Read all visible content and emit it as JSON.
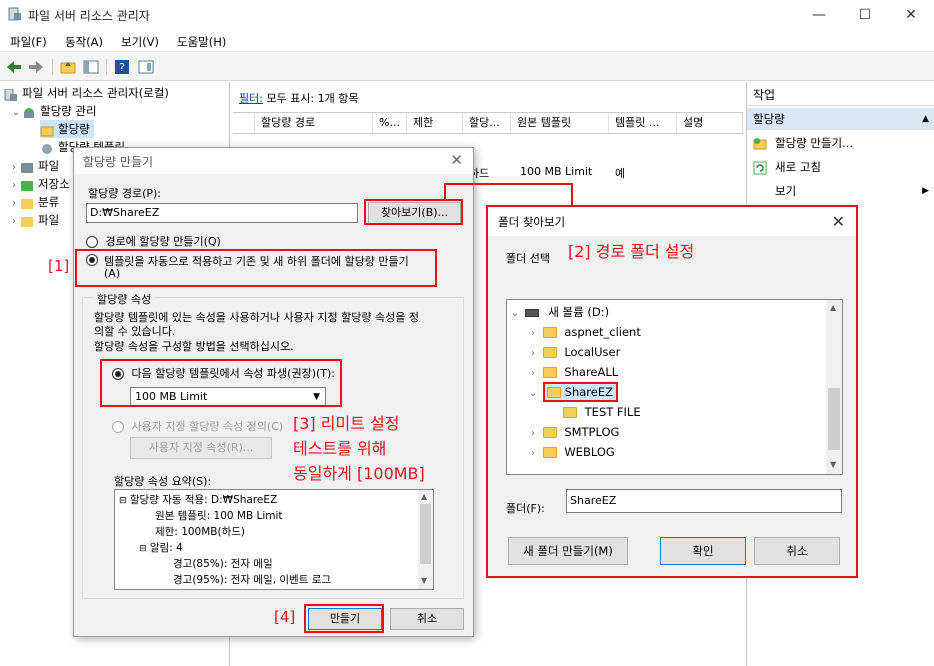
{
  "window": {
    "title": "파일 서버 리소스 관리자",
    "minimize_glyph": "—",
    "maximize_glyph": "☐",
    "close_glyph": "✕"
  },
  "menu": [
    "파일(F)",
    "동작(A)",
    "보기(V)",
    "도움말(H)"
  ],
  "toolbar_icons": [
    "back-arrow-icon",
    "forward-arrow-icon",
    "folder-up-icon",
    "show-hide-tree-icon",
    "help-icon",
    "properties-icon"
  ],
  "tree": {
    "root": "파일 서버 리소스 관리자(로컬)",
    "quota_management": "할당량 관리",
    "quotas": "할당량",
    "quota_templates": "할당량 템플릿",
    "file_screen": "파일",
    "storage_reports": "저장소",
    "classification": "분류",
    "file_management": "파일"
  },
  "center": {
    "filter_link": "필터:",
    "filter_text": "모두 표시: 1개 항목",
    "columns": [
      "할당량 경로",
      "%...",
      "제한",
      "할당...",
      "원본 템플릿",
      "템플릿 ...",
      "설명"
    ],
    "row": {
      "partial_type": "하드",
      "template": "100 MB Limit",
      "match": "예"
    }
  },
  "actions": {
    "title": "작업",
    "section": "할당량",
    "items": [
      "할당량 만들기...",
      "새로 고침",
      "보기"
    ]
  },
  "quota_dialog": {
    "title": "할당량 만들기",
    "path_label": "할당량 경로(P):",
    "path_value": "D:₩ShareEZ",
    "browse_button": "찾아보기(B)...",
    "radio_path": "경로에 할당량 만들기(Q)",
    "radio_auto_line1": "템플릿을 자동으로 적용하고 기존 및 새 하위 폴더에 할당량 만들기",
    "radio_auto_line2": "(A)",
    "props_group": "할당량 속성",
    "props_desc_line1": "할당량 템플릿에 있는 속성을 사용하거나 사용자 지정 할당량 속성을 정",
    "props_desc_line2": "의할 수 있습니다.",
    "props_desc_line3": "할당량 속성을 구성할 방법을 선택하십시오.",
    "radio_derive": "다음 할당량 템플릿에서 속성 파생(권장)(T):",
    "template_select": "100 MB Limit",
    "radio_custom": "사용자 지정 할당량 속성 정의(C)",
    "custom_button": "사용자 지정 속성(R)...",
    "summary_label": "할당량 속성 요약(S):",
    "summary_lines": [
      "할당량 자동 적용: D:₩ShareEZ",
      "원본 템플릿: 100 MB Limit",
      "제한: 100MB(하드)",
      "알림: 4",
      "경고(85%): 전자 메일",
      "경고(95%): 전자 메일, 이벤트 로그"
    ],
    "create_button": "만들기",
    "cancel_button": "취소"
  },
  "browse_dialog": {
    "title": "폴더 찾아보기",
    "select_label": "폴더 선택",
    "tree": [
      {
        "label": "새 볼륨 (D:)",
        "level": 0,
        "expanded": true,
        "drive": true
      },
      {
        "label": "aspnet_client",
        "level": 1
      },
      {
        "label": "LocalUser",
        "level": 1
      },
      {
        "label": "ShareALL",
        "level": 1
      },
      {
        "label": "ShareEZ",
        "level": 1,
        "expanded": true,
        "selected": true
      },
      {
        "label": "TEST FILE",
        "level": 2,
        "leaf": true
      },
      {
        "label": "SMTPLOG",
        "level": 1
      },
      {
        "label": "WEBLOG",
        "level": 1
      }
    ],
    "folder_label": "폴더(F):",
    "folder_value": "ShareEZ",
    "new_folder_button": "새 폴더 만들기(M)",
    "ok_button": "확인",
    "cancel_button": "취소"
  },
  "annotations": {
    "step1": "[1]",
    "step2": "[2] 경로 폴더 설정",
    "step3_line1": "[3] 리미트 설정",
    "step3_line2": "테스트를 위해",
    "step3_line3": "동일하게 [100MB]",
    "step4": "[4]",
    "accent_color": "#e0141e"
  }
}
